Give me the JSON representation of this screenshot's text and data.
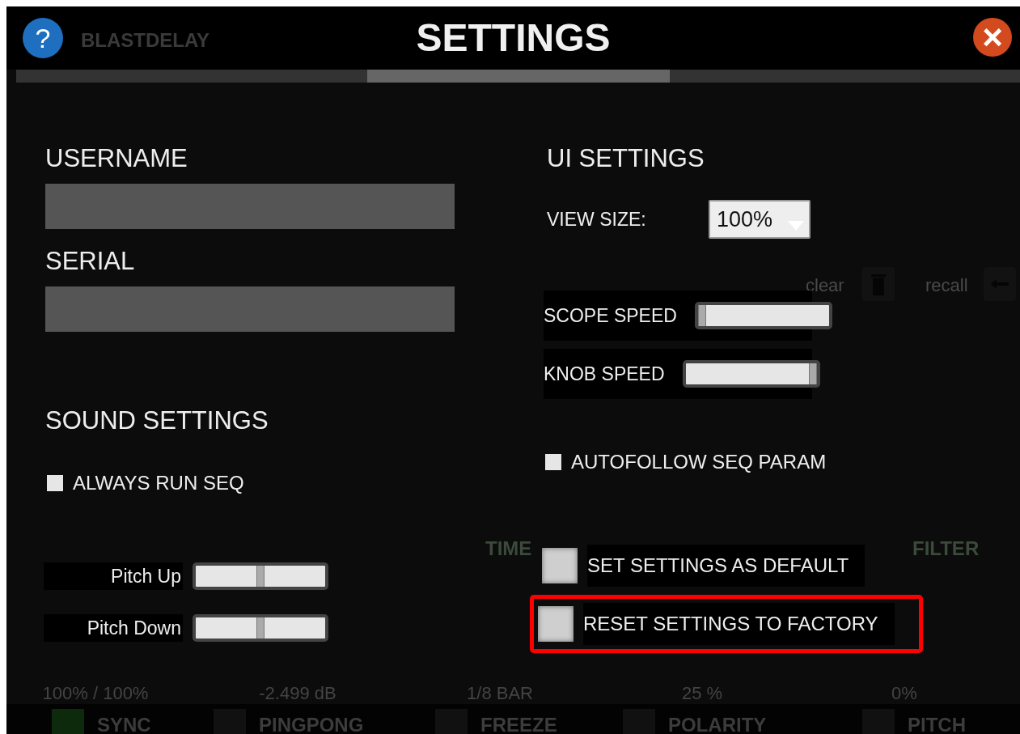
{
  "window": {
    "title": "SETTINGS",
    "help": "?",
    "close": "×"
  },
  "progress": {
    "level": 0.5
  },
  "backdrop": {
    "brand": "BLASTDELAY",
    "clear": "clear",
    "recall": "recall",
    "headers": [
      "TIME",
      "FILTER"
    ],
    "readouts": [
      "100% / 100%",
      "-2.499 dB",
      "1/8 BAR",
      "25 %",
      "0%"
    ],
    "toggles": [
      {
        "label": "SYNC",
        "on": true
      },
      {
        "label": "PINGPONG",
        "on": false
      },
      {
        "label": "FREEZE",
        "on": false
      },
      {
        "label": "POLARITY",
        "on": false
      },
      {
        "label": "PITCH",
        "on": false
      }
    ]
  },
  "account": {
    "username": {
      "label": "USERNAME"
    },
    "serial": {
      "label": "SERIAL"
    }
  },
  "sound_settings": {
    "title": "SOUND SETTINGS",
    "checkbox": {
      "label": "ALWAYS RUN SEQ",
      "checked": false
    },
    "sliders": [
      {
        "label": "Pitch Up",
        "level": 0.5
      },
      {
        "label": "Pitch Down",
        "level": 0.5
      }
    ]
  },
  "ui_settings": {
    "title": "UI SETTINGS",
    "view_size": {
      "label": "VIEW SIZE:",
      "value": "100%"
    },
    "sliders": [
      {
        "label": "SCOPE SPEED",
        "level": 0
      },
      {
        "label": "KNOB SPEED",
        "level": 1
      }
    ],
    "checkbox": {
      "label": "AUTOFOLLOW SEQ PARAM",
      "checked": false
    }
  },
  "actions": [
    {
      "label": "SET SETTINGS AS DEFAULT",
      "highlighted": false
    },
    {
      "label": "RESET SETTINGS TO FACTORY",
      "highlighted": true
    }
  ]
}
